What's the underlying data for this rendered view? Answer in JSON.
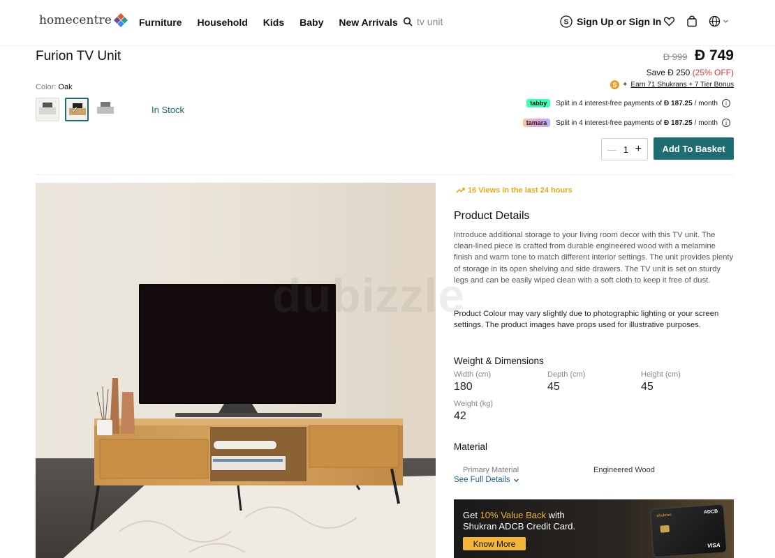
{
  "header": {
    "logo_text": "homecentre",
    "nav": [
      "Furniture",
      "Household",
      "Kids",
      "Baby",
      "New Arrivals"
    ],
    "search_placeholder": "tv unit",
    "signin_label": "Sign Up or Sign In",
    "icons": [
      "search-icon",
      "user-circle-icon",
      "heart-icon",
      "basket-icon",
      "globe-icon",
      "chevron-down-icon"
    ]
  },
  "product": {
    "title": "Furion TV Unit",
    "color_label": "Color:",
    "color_value": "Oak",
    "stock": "In Stock",
    "price_old": "Đ 999",
    "price_new": "Đ 749",
    "save_prefix": "Save Đ 250",
    "save_off": "(25% OFF)",
    "shukran_text": "Earn 71 Shukrans +  7  Tier Bonus",
    "tabby_badge": "tabby",
    "tamara_badge": "tamara",
    "installment_text": "Split in 4 interest-free payments of",
    "installment_amount": "Đ 187.25",
    "installment_suffix": "/ month",
    "quantity": "1",
    "add_to_basket": "Add To Basket",
    "views": "16 Views in the last 24 hours"
  },
  "details": {
    "heading": "Product Details",
    "description": "Introduce additional storage to your living room decor with this TV unit. The clean-lined piece is crafted from durable engineered wood with a melamine finish and warm tone to match different interior settings. The unit provides plenty of storage in its open shelving and side drawers. The TV unit is set on sturdy legs and can be easily wiped clean with a soft cloth to keep it free of dust.",
    "disclaimer": "Product Colour may vary slightly due to photographic lighting or your screen settings. The product images have props used for illustrative purposes.",
    "weight_dims_heading": "Weight & Dimensions",
    "dims": [
      {
        "label": "Width (cm)",
        "value": "180"
      },
      {
        "label": "Depth (cm)",
        "value": "45"
      },
      {
        "label": "Height (cm)",
        "value": "45"
      },
      {
        "label": "Weight (kg)",
        "value": "42"
      }
    ],
    "material_heading": "Material",
    "material_label": "Primary Material",
    "material_value": "Engineered Wood",
    "see_full": "See Full Details"
  },
  "banner": {
    "line1_prefix": "Get ",
    "line1_highlight": "10% Value Back",
    "line1_suffix": " with",
    "line2": "Shukran ADCB Credit Card.",
    "button": "Know More",
    "card_bank": "ADCB",
    "card_brand": "shukran",
    "card_network": "VISA"
  },
  "watermark": "dubizzle"
}
